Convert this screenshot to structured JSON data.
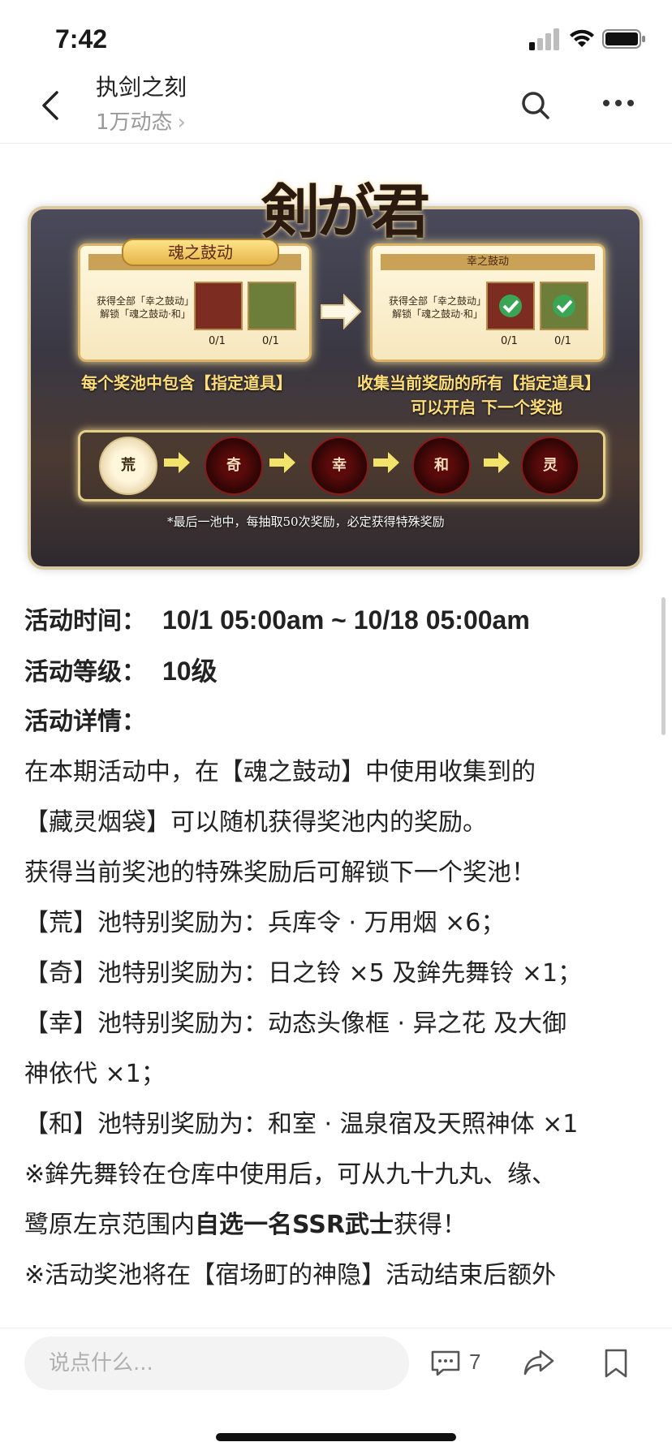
{
  "status_bar": {
    "time": "7:42"
  },
  "nav": {
    "title": "执剑之刻",
    "subtitle": "1万动态",
    "subtitle_chevron": "›"
  },
  "banner": {
    "logo_text": "剣が君",
    "left_tab": "魂之鼓动",
    "card_header": "幸之鼓动",
    "card_desc": "获得全部「幸之鼓动」解锁「魂之鼓动·和」",
    "count_a": "0/1",
    "count_b": "0/1",
    "caption_left": "每个奖池中包含【指定道具】",
    "caption_right_1": "收集当前奖励的所有【指定道具】",
    "caption_right_2": "可以开启 下一个奖池",
    "pools": [
      "荒",
      "奇",
      "幸",
      "和",
      "灵"
    ],
    "footnote": "*最后一池中，每抽取50次奖励，必定获得特殊奖励"
  },
  "article": {
    "time_label": "活动时间：",
    "time_value": "10/1 05:00am ~ 10/18 05:00am",
    "level_label": "活动等级：",
    "level_value": "10级",
    "detail_label": "活动详情：",
    "p1": "在本期活动中，在【魂之鼓动】中使用收集到的",
    "p2": "【藏灵烟袋】可以随机获得奖池内的奖励。",
    "p3": "获得当前奖池的特殊奖励后可解锁下一个奖池！",
    "p4": "【荒】池特别奖励为：兵库令 · 万用烟 ×6；",
    "p5": "【奇】池特别奖励为：日之铃 ×5 及鉾先舞铃 ×1；",
    "p6": "【幸】池特别奖励为：动态头像框 · 异之花 及大御",
    "p7": "神依代 ×1；",
    "p8": "【和】池特别奖励为：和室 · 温泉宿及天照神体 ×1",
    "p9": "※鉾先舞铃在仓库中使用后，可从九十九丸、缘、",
    "p10a": "鹭原左京范围内",
    "p10b": "自选一名SSR武士",
    "p10c": "获得！",
    "p11": "※活动奖池将在【宿场町的神隐】活动结束后额外"
  },
  "bottom_bar": {
    "comment_placeholder": "说点什么...",
    "comment_count": "7"
  }
}
